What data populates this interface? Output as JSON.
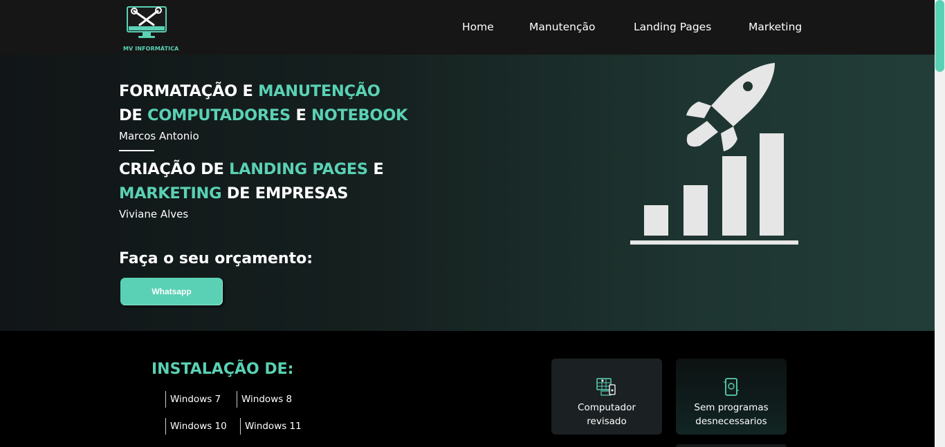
{
  "header": {
    "logo_text": "MV INFORMÁTICA",
    "nav": [
      "Home",
      "Manutenção",
      "Landing Pages",
      "Marketing"
    ]
  },
  "hero": {
    "block1": {
      "line1_a": "FORMATAÇÃO E ",
      "line1_b": "MANUTENÇÃO",
      "line2_a": "DE ",
      "line2_b": "COMPUTADORES",
      "line2_c": " E ",
      "line2_d": "NOTEBOOK",
      "name": "Marcos Antonio"
    },
    "block2": {
      "line1_a": "CRIAÇÃO DE ",
      "line1_b": "LANDING PAGES",
      "line1_c": " E",
      "line2_a": "MARKETING",
      "line2_b": " DE EMPRESAS",
      "name": "Viviane Alves"
    },
    "cta_title": "Faça o seu orçamento:",
    "cta_button": "Whatsapp",
    "illustration_icon": "rocket-growth-chart-icon"
  },
  "install": {
    "title": "INSTALAÇÃO DE:",
    "items": [
      "Windows 7",
      "Windows 8",
      "Windows 10",
      "Windows 11"
    ]
  },
  "cards": [
    {
      "label_line1": "Computador",
      "label_line2": "revisado",
      "icon": "computer-check-icon"
    },
    {
      "label_line1": "Sem programas",
      "label_line2": "desnecessarios",
      "icon": "clean-device-icon"
    }
  ],
  "colors": {
    "accent": "#5ad1b4",
    "header_bg": "#161616",
    "page_bg": "#000000"
  }
}
